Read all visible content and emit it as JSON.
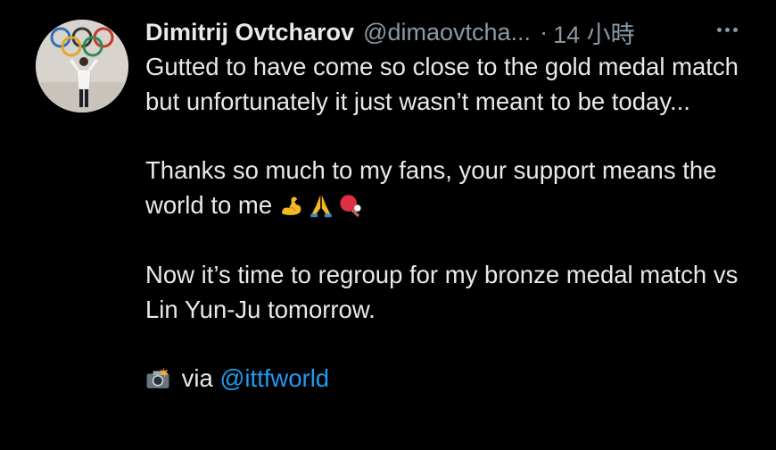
{
  "author": {
    "display_name": "Dimitrij Ovtcharov",
    "handle": "@dimaovtcha...",
    "time_separator": "·",
    "timestamp": "14 小時"
  },
  "tweet": {
    "paragraphs": [
      "Gutted to have come so close to the gold medal match but unfortunately it just wasn’t meant to be today...",
      "Thanks so much to my fans, your support means the world to me",
      "Now it’s time to regroup for my bronze medal match vs Lin Yun-Ju tomorrow."
    ],
    "emojis": [
      "flexed-biceps",
      "folded-hands",
      "ping-pong"
    ],
    "credit_text": "via",
    "credit_icon": "camera-flash-icon",
    "credit_mention": "@ittfworld"
  },
  "colors": {
    "background": "#000000",
    "text": "#e7e9ea",
    "secondary": "#8b98a5",
    "link": "#1d9bf0"
  }
}
